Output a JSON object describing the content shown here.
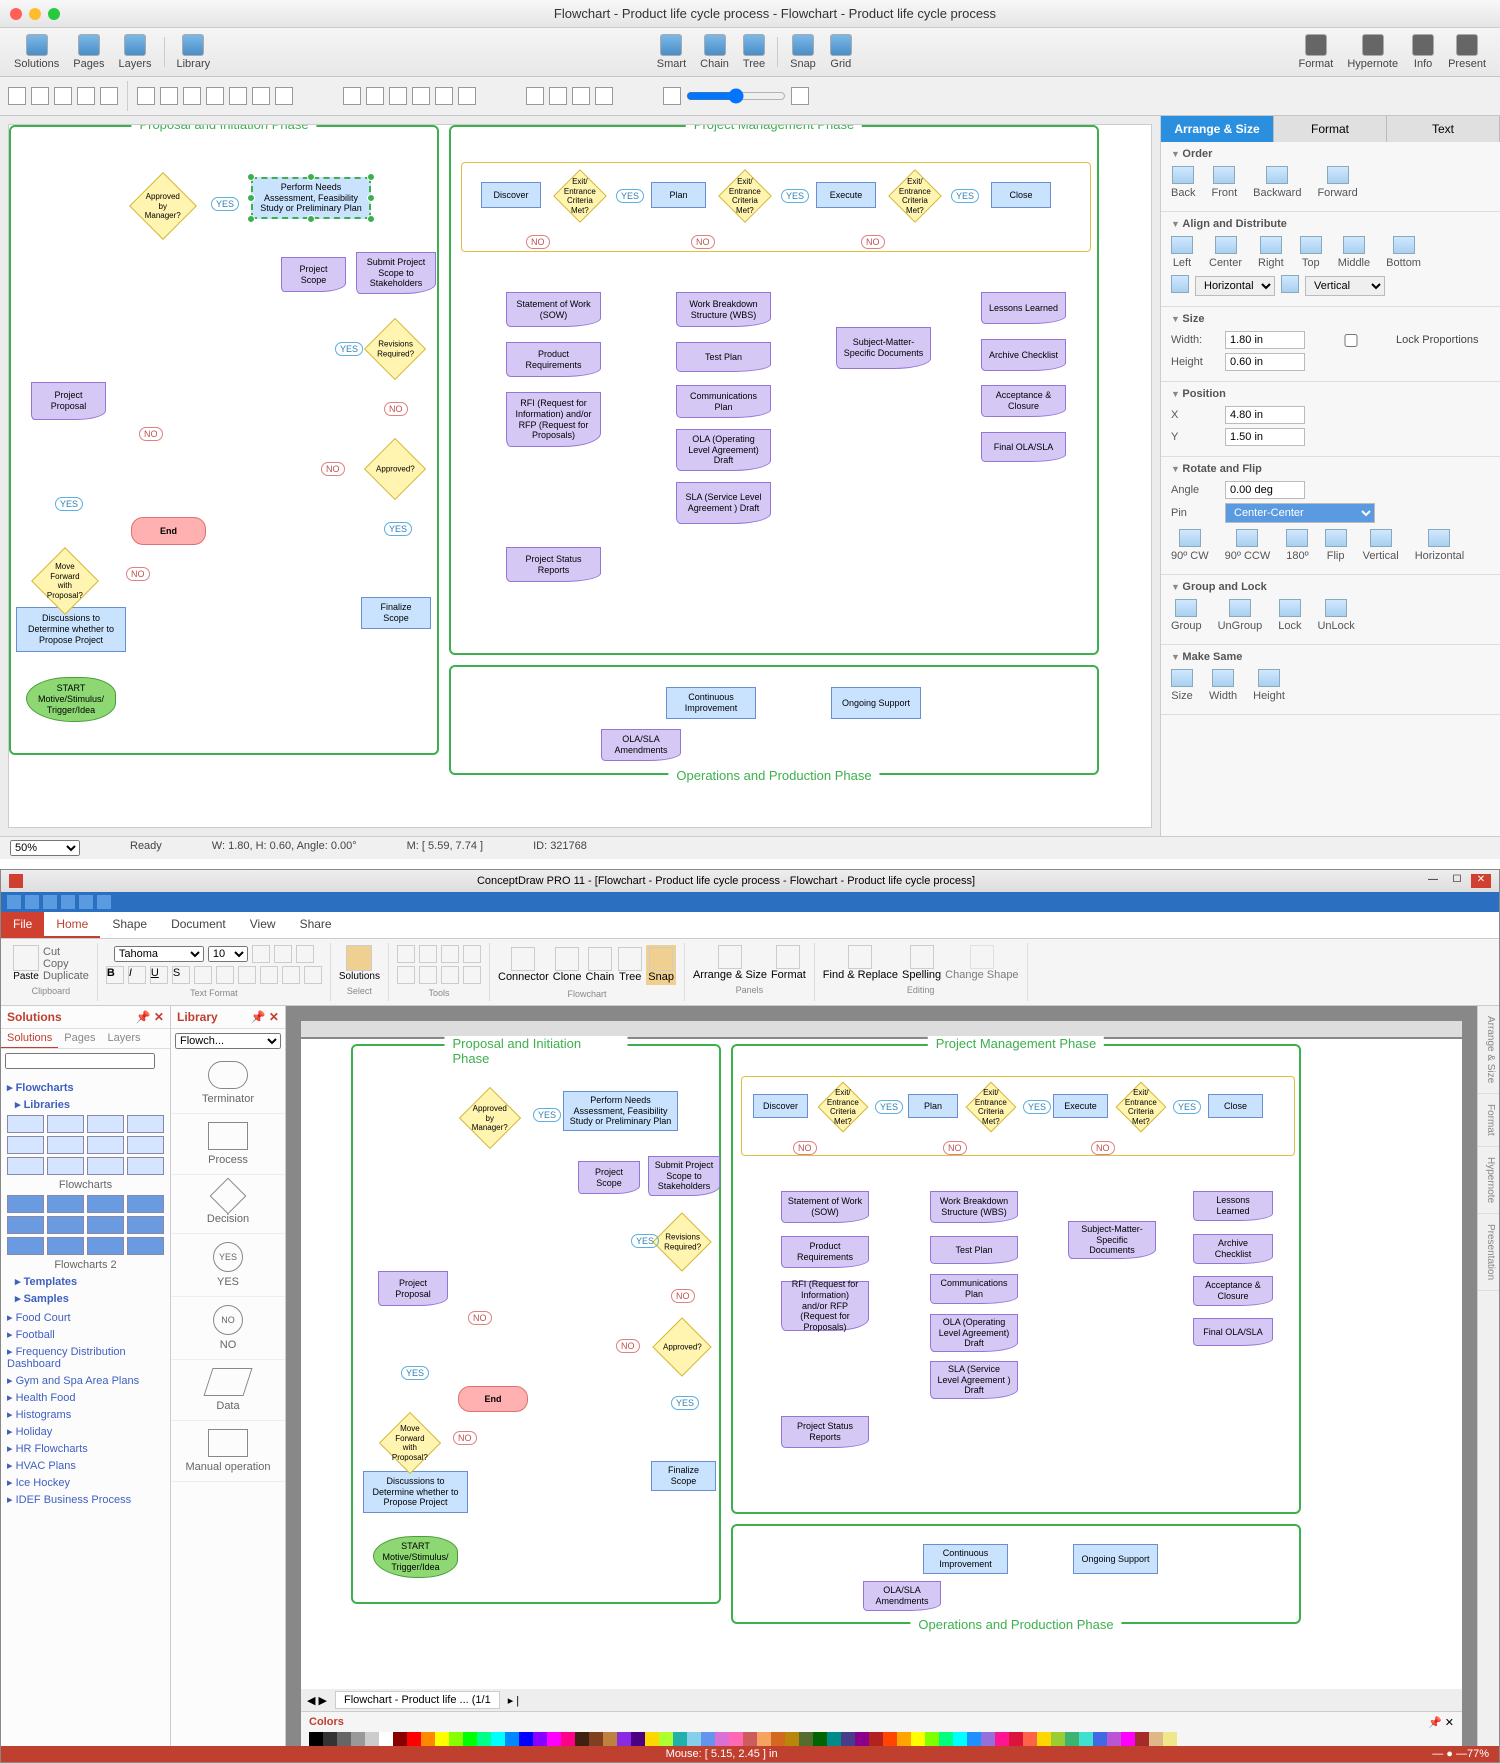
{
  "mac": {
    "title": "Flowchart - Product life cycle process - Flowchart - Product life cycle process",
    "toolbar1": [
      "Solutions",
      "Pages",
      "Layers",
      "Library",
      "Smart",
      "Chain",
      "Tree",
      "Snap",
      "Grid",
      "Format",
      "Hypernote",
      "Info",
      "Present"
    ],
    "zoom": "50%",
    "status_ready": "Ready",
    "status_wh": "W: 1.80,  H: 0.60,  Angle: 0.00°",
    "status_m": "M: [ 5.59, 7.74 ]",
    "status_id": "ID: 321768",
    "insp": {
      "tabs": [
        "Arrange & Size",
        "Format",
        "Text"
      ],
      "order": {
        "h": "Order",
        "items": [
          "Back",
          "Front",
          "Backward",
          "Forward"
        ]
      },
      "align": {
        "h": "Align and Distribute",
        "items": [
          "Left",
          "Center",
          "Right",
          "Top",
          "Middle",
          "Bottom"
        ],
        "sel1": "Horizontal",
        "sel2": "Vertical"
      },
      "size": {
        "h": "Size",
        "w_lbl": "Width:",
        "w": "1.80 in",
        "h_lbl": "Height",
        "hv": "0.60 in",
        "lock": "Lock Proportions"
      },
      "pos": {
        "h": "Position",
        "x_lbl": "X",
        "x": "4.80 in",
        "y_lbl": "Y",
        "y": "1.50 in"
      },
      "rot": {
        "h": "Rotate and Flip",
        "a_lbl": "Angle",
        "a": "0.00 deg",
        "p_lbl": "Pin",
        "p": "Center-Center",
        "items": [
          "90º CW",
          "90º CCW",
          "180º",
          "Flip",
          "Vertical",
          "Horizontal"
        ]
      },
      "grp": {
        "h": "Group and Lock",
        "items": [
          "Group",
          "UnGroup",
          "Lock",
          "UnLock"
        ]
      },
      "same": {
        "h": "Make Same",
        "items": [
          "Size",
          "Width",
          "Height"
        ]
      }
    }
  },
  "flow": {
    "phase1": "Proposal and Initiation Phase",
    "phase2": "Project Management Phase",
    "phase3": "Operations and Production Phase",
    "yes": "YES",
    "no": "NO",
    "start": "START Motive/Stimulus/ Trigger/Idea",
    "discuss": "Discussions to Determine whether to Propose Project",
    "forward": "Move Forward with Proposal?",
    "proposal": "Project Proposal",
    "approved_mgr": "Approved by Manager?",
    "needs": "Perform Needs Assessment, Feasibility Study or Preliminary Plan",
    "scope": "Project Scope",
    "submit": "Submit Project Scope to Stakeholders",
    "revisions": "Revisions Required?",
    "approved": "Approved?",
    "finalize": "Finalize Scope",
    "end": "End",
    "discover": "Discover",
    "plan": "Plan",
    "execute": "Execute",
    "close": "Close",
    "crit": "Exit/ Entrance Criteria Met?",
    "sow": "Statement of Work (SOW)",
    "preq": "Product Requirements",
    "rfi": "RFI (Request for Information) and/or RFP (Request for Proposals)",
    "psr": "Project Status Reports",
    "wbs": "Work Breakdown Structure (WBS)",
    "tplan": "Test Plan",
    "cplan": "Communications Plan",
    "ola": "OLA (Operating Level Agreement) Draft",
    "sla": "SLA (Service Level Agreement ) Draft",
    "sme": "Subject-Matter-Specific Documents",
    "lessons": "Lessons Learned",
    "archive": "Archive Checklist",
    "accept": "Acceptance & Closure",
    "fola": "Final OLA/SLA",
    "cont": "Continuous Improvement",
    "ongoing": "Ongoing Support",
    "amend": "OLA/SLA Amendments"
  },
  "win": {
    "title": "ConceptDraw PRO 11 - [Flowchart - Product life cycle process - Flowchart - Product life cycle process]",
    "tabs": [
      "File",
      "Home",
      "Shape",
      "Document",
      "View",
      "Share"
    ],
    "font": "Tahoma",
    "fontsize": "10",
    "rib_groups": [
      "Clipboard",
      "Text Format",
      "Select",
      "Tools",
      "Flowchart",
      "Panels",
      "Editing"
    ],
    "rib_paste": "Paste",
    "rib_cut": "Cut",
    "rib_copy": "Copy",
    "rib_dup": "Duplicate",
    "rib_solutions": "Solutions",
    "rib_connector": "Connector",
    "rib_clone": "Clone",
    "rib_chain": "Chain",
    "rib_tree": "Tree",
    "rib_snap": "Snap",
    "rib_arrsize": "Arrange & Size",
    "rib_format": "Format",
    "rib_find": "Find & Replace",
    "rib_spell": "Spelling",
    "rib_chshape": "Change Shape",
    "sol_panel": "Solutions",
    "lib_panel": "Library",
    "sol_tabs": [
      "Solutions",
      "Pages",
      "Layers"
    ],
    "lib_sel": "Flowch...",
    "tree": {
      "flowcharts": "Flowcharts",
      "libraries": "Libraries",
      "l1": "Flowcharts",
      "l2": "Flowcharts 2",
      "templates": "Templates",
      "samples": "Samples",
      "items": [
        "Food Court",
        "Football",
        "Frequency Distribution Dashboard",
        "Gym and Spa Area Plans",
        "Health Food",
        "Histograms",
        "Holiday",
        "HR Flowcharts",
        "HVAC Plans",
        "Ice Hockey",
        "IDEF Business Process"
      ]
    },
    "shapes": [
      {
        "n": "Terminator"
      },
      {
        "n": "Process"
      },
      {
        "n": "Decision"
      },
      {
        "n": "YES"
      },
      {
        "n": "NO"
      },
      {
        "n": "Data"
      },
      {
        "n": "Manual operation"
      }
    ],
    "vtabs": [
      "Arrange & Size",
      "Format",
      "Hypernote",
      "Presentation"
    ],
    "colors_lbl": "Colors",
    "tab_doc": "Flowchart - Product life ...  (1/1",
    "mouse": "Mouse: [ 5.15, 2.45 ] in",
    "zoom": "77%"
  }
}
